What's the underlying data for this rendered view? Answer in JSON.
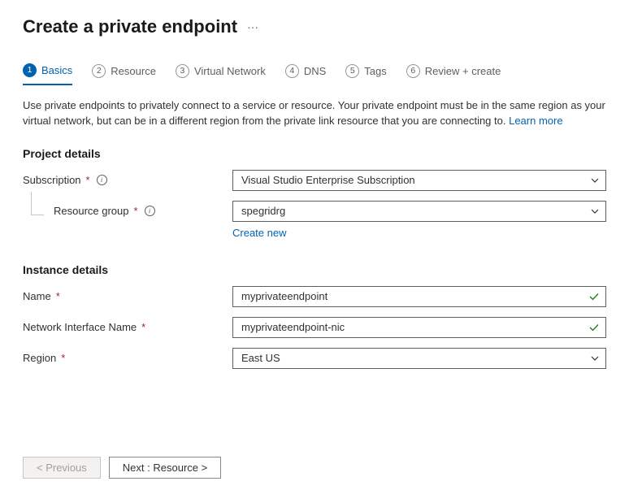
{
  "header": {
    "title": "Create a private endpoint",
    "ellipsis": "···"
  },
  "tabs": [
    {
      "num": "1",
      "label": "Basics"
    },
    {
      "num": "2",
      "label": "Resource"
    },
    {
      "num": "3",
      "label": "Virtual Network"
    },
    {
      "num": "4",
      "label": "DNS"
    },
    {
      "num": "5",
      "label": "Tags"
    },
    {
      "num": "6",
      "label": "Review + create"
    }
  ],
  "intro": {
    "text": "Use private endpoints to privately connect to a service or resource. Your private endpoint must be in the same region as your virtual network, but can be in a different region from the private link resource that you are connecting to. ",
    "link": "Learn more"
  },
  "project": {
    "heading": "Project details",
    "subscription_label": "Subscription",
    "subscription_value": "Visual Studio Enterprise Subscription",
    "resource_group_label": "Resource group",
    "resource_group_value": "spegridrg",
    "create_new": "Create new"
  },
  "instance": {
    "heading": "Instance details",
    "name_label": "Name",
    "name_value": "myprivateendpoint",
    "nic_label": "Network Interface Name",
    "nic_value": "myprivateendpoint-nic",
    "region_label": "Region",
    "region_value": "East US"
  },
  "footer": {
    "previous": "< Previous",
    "next": "Next : Resource >"
  }
}
